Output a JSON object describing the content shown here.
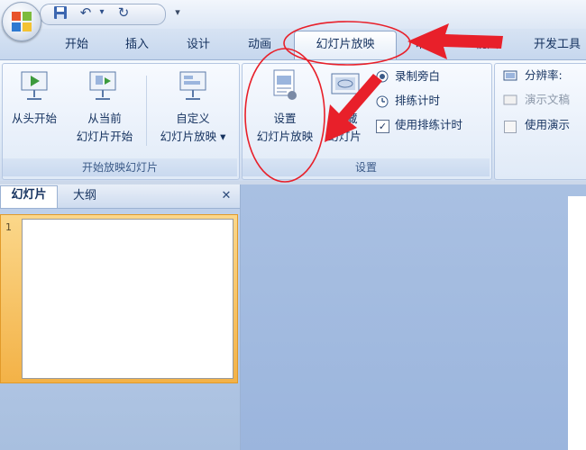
{
  "quick_access": {
    "save_icon": "save-icon",
    "undo_icon": "undo-icon",
    "redo_icon": "redo-icon"
  },
  "tabs": [
    "开始",
    "插入",
    "设计",
    "动画",
    "幻灯片放映",
    "审阅",
    "视图",
    "开发工具"
  ],
  "ribbon": {
    "group1": {
      "label": "开始放映幻灯片",
      "btn_from_start": "从头开始",
      "btn_from_current_1": "从当前",
      "btn_from_current_2": "幻灯片开始",
      "btn_custom_1": "自定义",
      "btn_custom_2": "幻灯片放映 ▾"
    },
    "group2": {
      "label": "设置",
      "btn_setup_1": "设置",
      "btn_setup_2": "幻灯片放映",
      "btn_hide_1": "隐藏",
      "btn_hide_2": "幻灯片",
      "record": "录制旁白",
      "rehearse": "排练计时",
      "use_timings": "使用排练计时"
    },
    "group3": {
      "resolution": "分辨率:",
      "presenter": "演示文稿",
      "use_presenter": "使用演示"
    }
  },
  "pane": {
    "tab_slides": "幻灯片",
    "tab_outline": "大纲",
    "close": "✕",
    "slide_number": "1"
  },
  "colors": {
    "annotation": "#e8202a",
    "selection": "#f3b247"
  }
}
